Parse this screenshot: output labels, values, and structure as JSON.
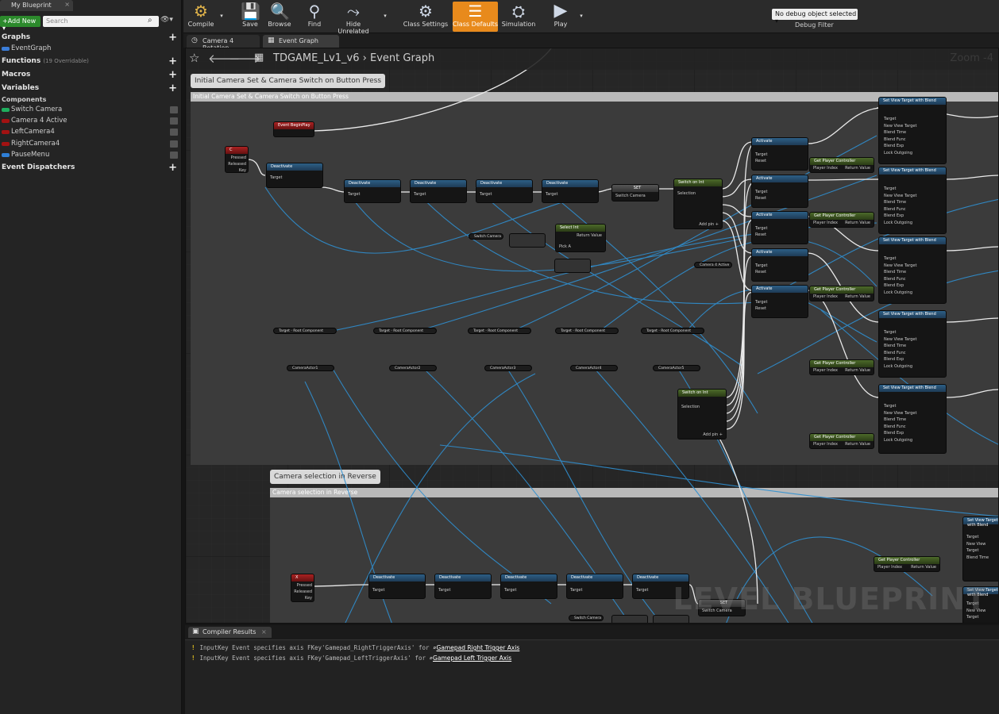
{
  "left_panel": {
    "tab_title": "My Blueprint",
    "add_new_label": "Add New",
    "search_placeholder": "Search",
    "sections": {
      "graphs": "Graphs",
      "functions": "Functions",
      "functions_note": "(19 Overridable)",
      "macros": "Macros",
      "variables": "Variables",
      "components": "Components",
      "event_dispatchers": "Event Dispatchers"
    },
    "event_graph": "EventGraph",
    "variables": [
      {
        "label": "Switch Camera",
        "color": "#1fae5e"
      },
      {
        "label": "Camera 4 Active",
        "color": "#a31212"
      },
      {
        "label": "LeftCamera4",
        "color": "#a31212"
      },
      {
        "label": "RightCamera4",
        "color": "#a31212"
      },
      {
        "label": "PauseMenu",
        "color": "#2f7fd6"
      }
    ]
  },
  "toolbar": {
    "compile": "Compile",
    "save": "Save",
    "browse": "Browse",
    "find": "Find",
    "hide_unrelated": "Hide Unrelated",
    "class_settings": "Class Settings",
    "class_defaults": "Class Defaults",
    "simulation": "Simulation",
    "play": "Play",
    "debug_selected": "No debug object selected",
    "debug_filter": "Debug Filter"
  },
  "doc_tabs": [
    "Camera 4 Rotation",
    "Event Graph"
  ],
  "graph": {
    "breadcrumb_level": "TDGAME_Lv1_v6",
    "breadcrumb_sep": "›",
    "breadcrumb_graph": "Event Graph",
    "zoom": "Zoom -4",
    "comment1": "Initial Camera Set & Camera Switch on Button Press",
    "comment2": "Camera selection in Reverse",
    "watermark": "LEVEL BLUEPRINT",
    "nodes": {
      "event_begin_play": "Event BeginPlay",
      "deactivate": "Deactivate",
      "activate": "Activate",
      "set": "SET",
      "switch_on_int": "Switch on Int",
      "select_int": "Select Int",
      "set_view_target": "Set View Target with Blend",
      "get_player_controller": "Get Player Controller",
      "switch_camera": "Switch Camera",
      "camera4_active": "Camera 4 Active",
      "root_component": "Root Component",
      "camera_actors": [
        "CameraActor1",
        "CameraActor2",
        "CameraActor3",
        "CameraActor4",
        "CameraActor5"
      ],
      "key_c": "C",
      "key_x": "X",
      "pressed": "Pressed",
      "released": "Released",
      "key": "Key",
      "target": "Target",
      "return_value": "Return Value",
      "add_pin": "Add pin",
      "selection": "Selection",
      "new_view_target": "New View Target",
      "blend_time": "Blend Time",
      "blend_func": "Blend Func",
      "blend_func_value": "VTBlend Ease In",
      "blend_exp": "Blend Exp",
      "lock_outgoing": "Lock Outgoing",
      "player_index": "Player Index",
      "reset": "Reset",
      "pick_a": "Pick A"
    }
  },
  "compiler": {
    "tab": "Compiler Results",
    "messages": [
      {
        "text": "InputKey Event specifies axis FKey'Gamepad_RightTriggerAxis' for",
        "link": "Gamepad Right Trigger Axis"
      },
      {
        "text": "InputKey Event specifies axis FKey'Gamepad_LeftTriggerAxis' for",
        "link": "Gamepad Left Trigger Axis"
      }
    ]
  }
}
